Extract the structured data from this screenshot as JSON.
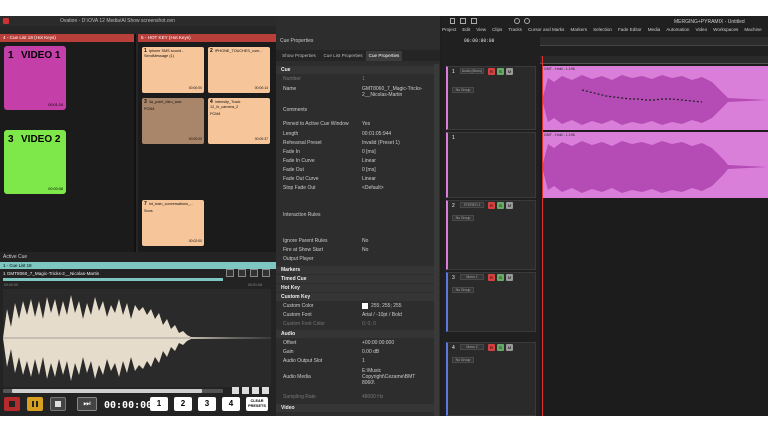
{
  "ovation": {
    "title": "Ovation - D:\\OVA 12 Media\\Al Show screenshot.ovn",
    "cue_list_header": "4 - Cue List 18 (Hot Keys)",
    "hotkey_header": "5 - HOT KEY (Hot Keys)",
    "big_cues": [
      {
        "num": "1",
        "title": "VIDEO 1",
        "duration": "00:01:24",
        "color": "#c43fa8"
      },
      {
        "num": "3",
        "title": "VIDEO 2",
        "duration": "00:00:08",
        "color": "#7ee84b"
      }
    ],
    "hotkeys": [
      {
        "num": "1",
        "title": "Iphone SMS sound - SendMessage (1)",
        "ext": "",
        "duration": "00:00:00",
        "color": "#f6c59a"
      },
      {
        "num": "2",
        "title": "IPHONE_TOUCHES_com...",
        "ext": "",
        "duration": "00:00:14",
        "color": "#f6c59a"
      },
      {
        "num": "3",
        "title": "3a_point_bleu_wav",
        "ext": "PCM4",
        "duration": "00:00:00",
        "color": "#a9866a"
      },
      {
        "num": "4",
        "title": "Intensity_Track 12_fx_camera_2",
        "ext": "PCM4",
        "duration": "00:00:37",
        "color": "#f6c59a"
      },
      {
        "num": "7",
        "title": "Int_train_conversations_...",
        "ext": "Sons",
        "duration": "00:02:00",
        "color": "#f6c59a"
      }
    ],
    "active_cue": {
      "header": "Active Cue",
      "list_label": "1 - Cue List 18",
      "cue_name": "1 GMT8060_7_Magic-Tricks-2__Nicolas-Martin",
      "time_left": "00:00:00",
      "time_mid": "00:01:08",
      "time_right": "00:01:08"
    },
    "transport": {
      "timecode": "00:00:00",
      "presets": [
        "1",
        "2",
        "3",
        "4"
      ],
      "clear_label": "CLEAR PRESETS"
    }
  },
  "props": {
    "title": "Cue Properties",
    "tabs": [
      "Show Properties",
      "Cue List Properties",
      "Cue Properties"
    ],
    "rows_top": [
      {
        "label": "Cue",
        "value": "",
        "section": true
      },
      {
        "label": "Number",
        "value": "1",
        "dim": true
      },
      {
        "label": "Name",
        "value": "GMT8060_7_Magic-Tricks-2__Nicolas-Martin"
      }
    ],
    "comments_label": "Comments",
    "rows_mid": [
      {
        "label": "Pinned to Active Cue Window",
        "value": "Yes"
      },
      {
        "label": "Length",
        "value": "00:01:05:944"
      },
      {
        "label": "Rehearsal Preset",
        "value": "Invalid (Preset 1)"
      },
      {
        "label": "Fade In",
        "value": "0 [ms]"
      },
      {
        "label": "Fade In Curve",
        "value": "Linear"
      },
      {
        "label": "Fade Out",
        "value": "0 [ms]"
      },
      {
        "label": "Fade Out Curve",
        "value": "Linear"
      },
      {
        "label": "Stop Fade Out",
        "value": "<Default>"
      }
    ],
    "interaction_label": "Interaction Rules",
    "rows_low": [
      {
        "label": "Ignore Parent Rules",
        "value": "No"
      },
      {
        "label": "Fire at Show Start",
        "value": "No"
      },
      {
        "label": "Output Player",
        "value": ""
      }
    ],
    "sections_2": [
      "Markers",
      "Timed Cue",
      "Hot Key",
      "Custom Key"
    ],
    "custom_key": [
      {
        "label": "Custom Color",
        "value": "255; 255; 255"
      },
      {
        "label": "Custom Font",
        "value": "Arial / -10pt / Bold"
      },
      {
        "label": "Custom Font Color",
        "value": "0; 0; 0",
        "dim": true
      }
    ],
    "audio_section": "Audio",
    "audio": [
      {
        "label": "Offset",
        "value": "+00:00:00:000"
      },
      {
        "label": "Gain",
        "value": "0.00 dB"
      },
      {
        "label": "Audio Output Slot",
        "value": "1"
      }
    ],
    "audio_media_label": "Audio Media",
    "audio_media_value": "E:\\Music Copyright\\Cezame\\BMT 8060\\",
    "sampling_label": "Sampling Rate",
    "sampling_value": "48000 Hz",
    "video_section": "Video"
  },
  "pyramix": {
    "title": "MERGING+PYRAMIX - Untitled",
    "menu": [
      "Project",
      "Edit",
      "View",
      "Clips",
      "Tracks",
      "Cursor and Marks",
      "Markers",
      "Selection",
      "Fade Editor",
      "Media",
      "Automation",
      "Video",
      "Workspaces",
      "Machine"
    ],
    "timecode": "00:00:00:00",
    "track_labels": [
      "1",
      "2",
      "3",
      "4"
    ],
    "track_names": [
      "Audio (Mono)",
      "",
      "STEREO 2",
      "Mono 1",
      "Mono 2"
    ],
    "clip_label": "GMT - Hold - 1.196",
    "nogroup": "No Group",
    "colors": {
      "clip": "#d97fd9",
      "clip_dark": "#b54bb5",
      "playhead": "#e03030"
    }
  }
}
